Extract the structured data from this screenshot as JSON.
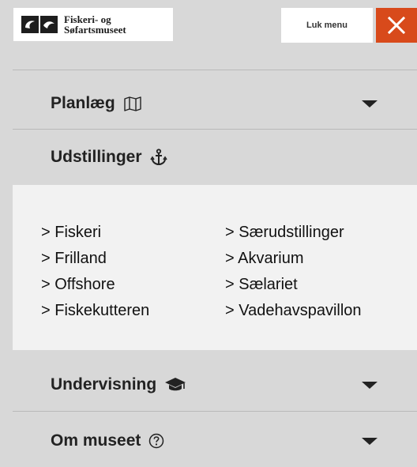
{
  "logo": {
    "line1": "Fiskeri- og",
    "line2": "Søfartsmuseet",
    "icon": "wave-logo-icon"
  },
  "header": {
    "close_menu_label": "Luk menu",
    "close_icon": "close-icon",
    "close_color": "#d84a1b"
  },
  "menu": {
    "plan": {
      "label": "Planlæg",
      "icon": "map-icon"
    },
    "exhibitions": {
      "label": "Udstillinger",
      "icon": "anchor-icon",
      "left_links": [
        "> Fiskeri",
        "> Frilland",
        "> Offshore",
        "> Fiskekutteren"
      ],
      "right_links": [
        "> Særudstillinger",
        "> Akvarium",
        "> Sælariet",
        "> Vadehavspavillon"
      ]
    },
    "teaching": {
      "label": "Undervisning",
      "icon": "graduation-cap-icon"
    },
    "about": {
      "label": "Om museet",
      "icon": "question-circle-icon"
    }
  }
}
